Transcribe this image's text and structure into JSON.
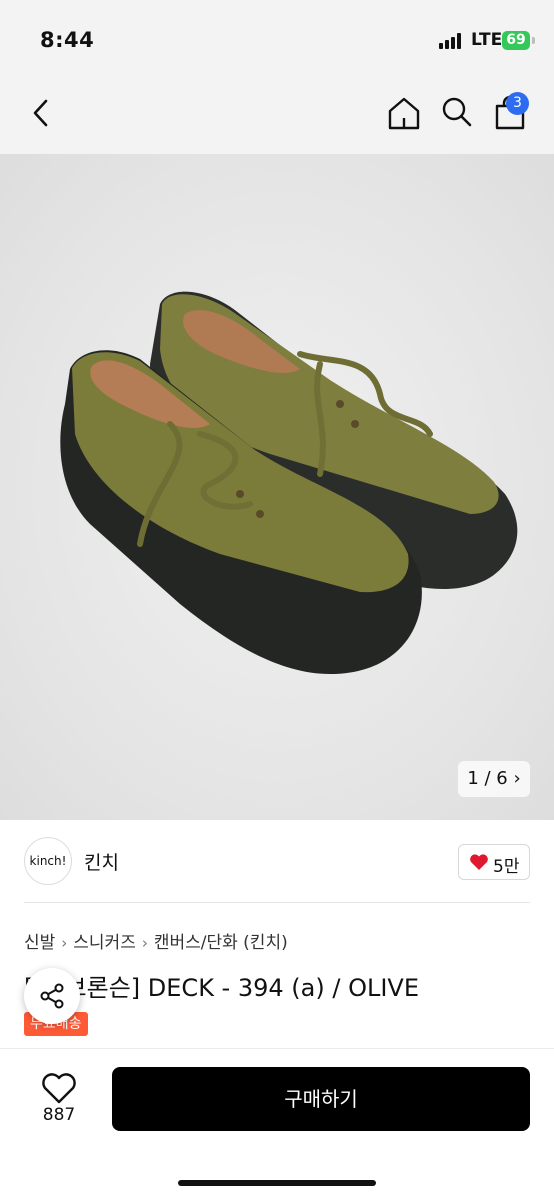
{
  "status_bar": {
    "time": "8:44",
    "network": "LTE",
    "battery": "69"
  },
  "nav": {
    "cart_count": "3",
    "icons": [
      "back-icon",
      "home-icon",
      "search-icon",
      "shopping-bag-icon"
    ]
  },
  "gallery": {
    "pager": "1 / 6 ›"
  },
  "shop": {
    "logo_text": "kinch!",
    "name": "킨치",
    "likes": "5만"
  },
  "breadcrumb": {
    "items": [
      "신발",
      "스니커즈",
      "캔버스/단화 (킨치)"
    ],
    "separator": "›"
  },
  "product": {
    "title": "[   ]x브론슨] DECK - 394 (a) / OLIVE",
    "badge": "무료배송"
  },
  "bottom_bar": {
    "wish_count": "887",
    "buy_label": "구매하기"
  },
  "colors": {
    "cart_badge": "#2d6bf1",
    "badge_bg": "#ff5a36",
    "buy_bg": "#000000",
    "heart": "#e0182d"
  }
}
